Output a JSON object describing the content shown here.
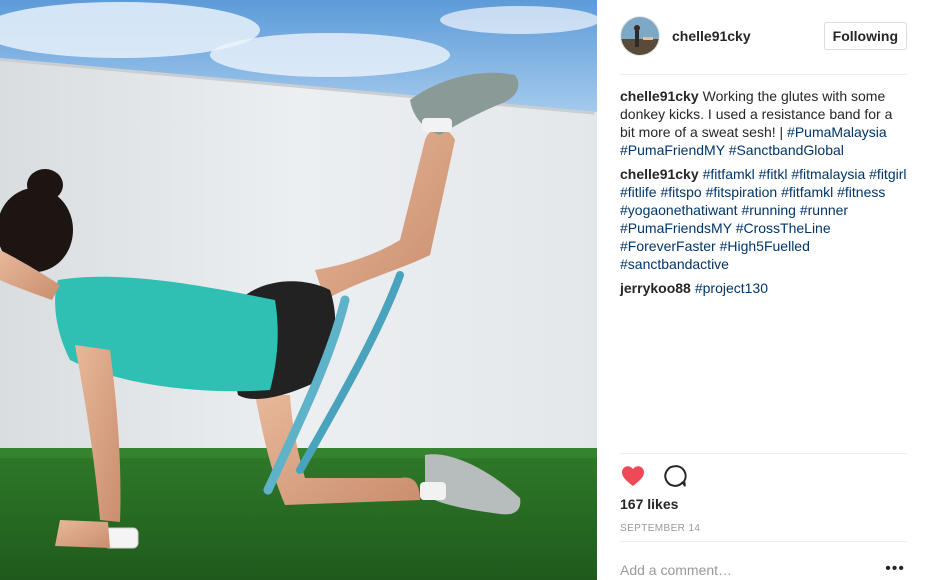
{
  "post": {
    "author": "chelle91cky",
    "follow_label": "Following",
    "likes": "167 likes",
    "date": "SEPTEMBER 14",
    "add_comment_placeholder": "Add a comment…",
    "more_label": "•••"
  },
  "comments": [
    {
      "author": "chelle91cky",
      "text": "Working the glutes with some donkey kicks. I used a resistance band for a bit more of a sweat sesh! | ",
      "tags": [
        "#PumaMalaysia",
        "#PumaFriendMY",
        "#SanctbandGlobal"
      ]
    },
    {
      "author": "chelle91cky",
      "text": "",
      "tags": [
        "#fitfamkl",
        "#fitkl",
        "#fitmalaysia",
        "#fitgirl",
        "#fitlife",
        "#fitspo",
        "#fitspiration",
        "#fitfamkl",
        "#fitness",
        "#yogaonethatiwant",
        "#running",
        "#runner",
        "#PumaFriendsMY",
        "#CrossTheLine",
        "#ForeverFaster",
        "#High5Fuelled",
        "#sanctbandactive"
      ]
    },
    {
      "author": "jerrykoo88",
      "text": "",
      "tags": [
        "#project130"
      ]
    }
  ],
  "icons": {
    "like": "heart-icon",
    "comment": "comment-bubble-icon"
  },
  "colors": {
    "hashtag": "#003569",
    "heart": "#ed4956",
    "muted": "#999999"
  }
}
